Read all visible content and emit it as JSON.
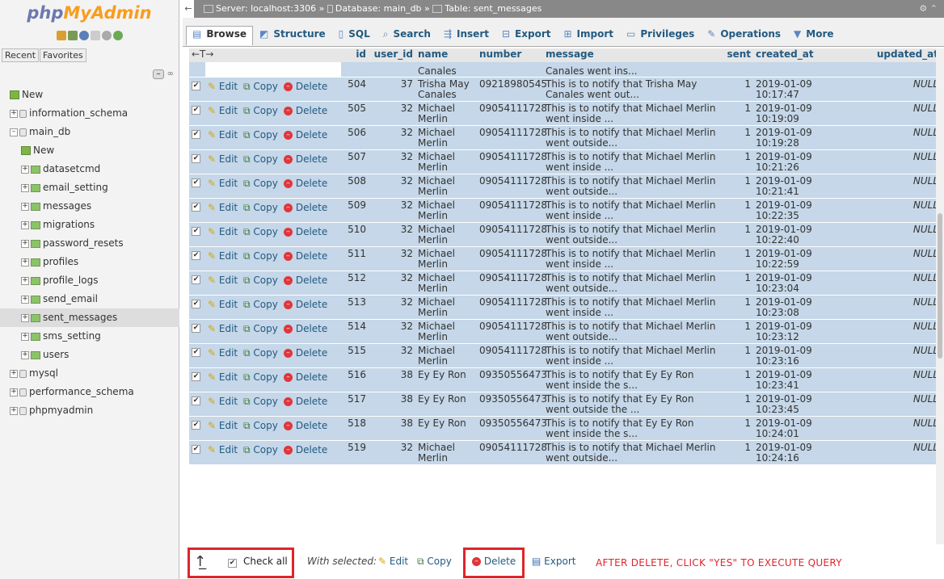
{
  "sidebar": {
    "logo_a": "php",
    "logo_b": "MyAdmin",
    "tab_recent": "Recent",
    "tab_favorites": "Favorites",
    "tree": [
      {
        "label": "New",
        "indent": 0,
        "kind": "new"
      },
      {
        "label": "information_schema",
        "indent": 0,
        "kind": "db"
      },
      {
        "label": "main_db",
        "indent": 0,
        "kind": "db-open"
      },
      {
        "label": "New",
        "indent": 1,
        "kind": "new"
      },
      {
        "label": "datasetcmd",
        "indent": 1,
        "kind": "table"
      },
      {
        "label": "email_setting",
        "indent": 1,
        "kind": "table"
      },
      {
        "label": "messages",
        "indent": 1,
        "kind": "table"
      },
      {
        "label": "migrations",
        "indent": 1,
        "kind": "table"
      },
      {
        "label": "password_resets",
        "indent": 1,
        "kind": "table"
      },
      {
        "label": "profiles",
        "indent": 1,
        "kind": "table"
      },
      {
        "label": "profile_logs",
        "indent": 1,
        "kind": "table"
      },
      {
        "label": "send_email",
        "indent": 1,
        "kind": "table"
      },
      {
        "label": "sent_messages",
        "indent": 1,
        "kind": "table",
        "selected": true
      },
      {
        "label": "sms_setting",
        "indent": 1,
        "kind": "table"
      },
      {
        "label": "users",
        "indent": 1,
        "kind": "table"
      },
      {
        "label": "mysql",
        "indent": 0,
        "kind": "db"
      },
      {
        "label": "performance_schema",
        "indent": 0,
        "kind": "db"
      },
      {
        "label": "phpmyadmin",
        "indent": 0,
        "kind": "db"
      }
    ]
  },
  "breadcrumb": {
    "server": "Server: localhost:3306",
    "database": "Database: main_db",
    "table": "Table: sent_messages"
  },
  "tabs": [
    {
      "label": "Browse",
      "icon": "browse-icon",
      "active": true
    },
    {
      "label": "Structure",
      "icon": "structure-icon"
    },
    {
      "label": "SQL",
      "icon": "sql-icon"
    },
    {
      "label": "Search",
      "icon": "search-icon"
    },
    {
      "label": "Insert",
      "icon": "insert-icon"
    },
    {
      "label": "Export",
      "icon": "export-icon"
    },
    {
      "label": "Import",
      "icon": "import-icon"
    },
    {
      "label": "Privileges",
      "icon": "privileges-icon"
    },
    {
      "label": "Operations",
      "icon": "operations-icon"
    },
    {
      "label": "More",
      "icon": "chevron-down-icon"
    }
  ],
  "columns": [
    "id",
    "user_id",
    "name",
    "number",
    "message",
    "sent",
    "created_at",
    "updated_at"
  ],
  "sort_arrows": "←T→",
  "actions": {
    "edit": "Edit",
    "copy": "Copy",
    "delete": "Delete"
  },
  "partial_row": {
    "name": "Canales",
    "message": "Canales went ins..."
  },
  "rows": [
    {
      "id": "504",
      "user_id": "37",
      "name": "Trisha May Canales",
      "number": "09218980545",
      "message": "This is to notify that Trisha May Canales went out...",
      "sent": "1",
      "created_at": "2019-01-09 10:17:47",
      "updated_at": "NULL"
    },
    {
      "id": "505",
      "user_id": "32",
      "name": "Michael Merlin",
      "number": "09054111728",
      "message": "This is to notify that Michael Merlin went inside ...",
      "sent": "1",
      "created_at": "2019-01-09 10:19:09",
      "updated_at": "NULL"
    },
    {
      "id": "506",
      "user_id": "32",
      "name": "Michael Merlin",
      "number": "09054111728",
      "message": "This is to notify that Michael Merlin went outside...",
      "sent": "1",
      "created_at": "2019-01-09 10:19:28",
      "updated_at": "NULL"
    },
    {
      "id": "507",
      "user_id": "32",
      "name": "Michael Merlin",
      "number": "09054111728",
      "message": "This is to notify that Michael Merlin went inside ...",
      "sent": "1",
      "created_at": "2019-01-09 10:21:26",
      "updated_at": "NULL"
    },
    {
      "id": "508",
      "user_id": "32",
      "name": "Michael Merlin",
      "number": "09054111728",
      "message": "This is to notify that Michael Merlin went outside...",
      "sent": "1",
      "created_at": "2019-01-09 10:21:41",
      "updated_at": "NULL"
    },
    {
      "id": "509",
      "user_id": "32",
      "name": "Michael Merlin",
      "number": "09054111728",
      "message": "This is to notify that Michael Merlin went inside ...",
      "sent": "1",
      "created_at": "2019-01-09 10:22:35",
      "updated_at": "NULL"
    },
    {
      "id": "510",
      "user_id": "32",
      "name": "Michael Merlin",
      "number": "09054111728",
      "message": "This is to notify that Michael Merlin went outside...",
      "sent": "1",
      "created_at": "2019-01-09 10:22:40",
      "updated_at": "NULL"
    },
    {
      "id": "511",
      "user_id": "32",
      "name": "Michael Merlin",
      "number": "09054111728",
      "message": "This is to notify that Michael Merlin went inside ...",
      "sent": "1",
      "created_at": "2019-01-09 10:22:59",
      "updated_at": "NULL"
    },
    {
      "id": "512",
      "user_id": "32",
      "name": "Michael Merlin",
      "number": "09054111728",
      "message": "This is to notify that Michael Merlin went outside...",
      "sent": "1",
      "created_at": "2019-01-09 10:23:04",
      "updated_at": "NULL"
    },
    {
      "id": "513",
      "user_id": "32",
      "name": "Michael Merlin",
      "number": "09054111728",
      "message": "This is to notify that Michael Merlin went inside ...",
      "sent": "1",
      "created_at": "2019-01-09 10:23:08",
      "updated_at": "NULL"
    },
    {
      "id": "514",
      "user_id": "32",
      "name": "Michael Merlin",
      "number": "09054111728",
      "message": "This is to notify that Michael Merlin went outside...",
      "sent": "1",
      "created_at": "2019-01-09 10:23:12",
      "updated_at": "NULL"
    },
    {
      "id": "515",
      "user_id": "32",
      "name": "Michael Merlin",
      "number": "09054111728",
      "message": "This is to notify that Michael Merlin went inside ...",
      "sent": "1",
      "created_at": "2019-01-09 10:23:16",
      "updated_at": "NULL"
    },
    {
      "id": "516",
      "user_id": "38",
      "name": "Ey Ey Ron",
      "number": "09350556473",
      "message": "This is to notify that Ey Ey Ron went inside the s...",
      "sent": "1",
      "created_at": "2019-01-09 10:23:41",
      "updated_at": "NULL"
    },
    {
      "id": "517",
      "user_id": "38",
      "name": "Ey Ey Ron",
      "number": "09350556473",
      "message": "This is to notify that Ey Ey Ron went outside the ...",
      "sent": "1",
      "created_at": "2019-01-09 10:23:45",
      "updated_at": "NULL"
    },
    {
      "id": "518",
      "user_id": "38",
      "name": "Ey Ey Ron",
      "number": "09350556473",
      "message": "This is to notify that Ey Ey Ron went inside the s...",
      "sent": "1",
      "created_at": "2019-01-09 10:24:01",
      "updated_at": "NULL"
    },
    {
      "id": "519",
      "user_id": "32",
      "name": "Michael Merlin",
      "number": "09054111728",
      "message": "This is to notify that Michael Merlin went outside...",
      "sent": "1",
      "created_at": "2019-01-09 10:24:16",
      "updated_at": "NULL"
    }
  ],
  "bottom": {
    "check_all": "Check all",
    "with_selected": "With selected:",
    "edit": "Edit",
    "copy": "Copy",
    "delete": "Delete",
    "export": "Export",
    "note": "AFTER DELETE, CLICK \"YES\" TO EXECUTE QUERY"
  },
  "colors": {
    "highlight": "#e0242a",
    "row_bg": "#c5d7e8",
    "link": "#235a81"
  }
}
